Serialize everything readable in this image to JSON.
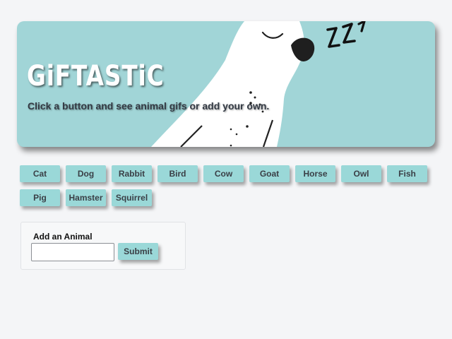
{
  "header": {
    "logo": "GiFTASTiC",
    "tagline": "Click a button and see animal gifs or add your own."
  },
  "animal_buttons": [
    "Cat",
    "Dog",
    "Rabbit",
    "Bird",
    "Cow",
    "Goat",
    "Horse",
    "Owl",
    "Fish",
    "Pig",
    "Hamster",
    "Squirrel"
  ],
  "add_form": {
    "label": "Add an Animal",
    "input_value": "",
    "submit_label": "Submit"
  },
  "colors": {
    "banner": "#a1d5d7",
    "button": "#9ad8d8",
    "page_background": "#f4f5f7"
  },
  "icons": [
    "sleeping-bird-illustration",
    "zzz-icon"
  ]
}
